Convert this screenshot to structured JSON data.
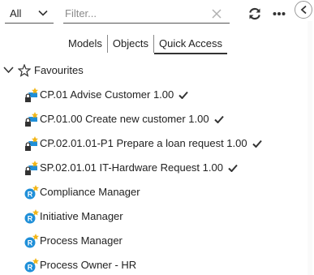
{
  "filter": {
    "scope_value": "All",
    "placeholder": "Filter...",
    "value": ""
  },
  "tabs": [
    {
      "label": "Models",
      "active": false
    },
    {
      "label": "Objects",
      "active": false
    },
    {
      "label": "Quick Access",
      "active": true
    }
  ],
  "favourites": {
    "label": "Favourites",
    "expanded": true,
    "items": [
      {
        "label": "CP.01 Advise Customer 1.00",
        "icon": "locked-process-model-icon",
        "checked": true
      },
      {
        "label": "CP.01.00 Create new customer 1.00",
        "icon": "locked-process-model-icon",
        "checked": true
      },
      {
        "label": "CP.02.01.01-P1 Prepare a loan request 1.00",
        "icon": "locked-process-model-icon",
        "checked": true
      },
      {
        "label": "SP.02.01.01 IT-Hardware Request 1.00",
        "icon": "locked-process-model-icon",
        "checked": true
      },
      {
        "label": "Compliance Manager",
        "icon": "role-icon",
        "checked": false
      },
      {
        "label": "Initiative Manager",
        "icon": "role-icon",
        "checked": false
      },
      {
        "label": "Process Manager",
        "icon": "role-icon",
        "checked": false
      },
      {
        "label": "Process Owner - HR",
        "icon": "role-icon",
        "checked": false
      }
    ]
  },
  "colors": {
    "accent": "#1f8fd8",
    "favourite_star": "#f2b619",
    "text": "#222222"
  }
}
